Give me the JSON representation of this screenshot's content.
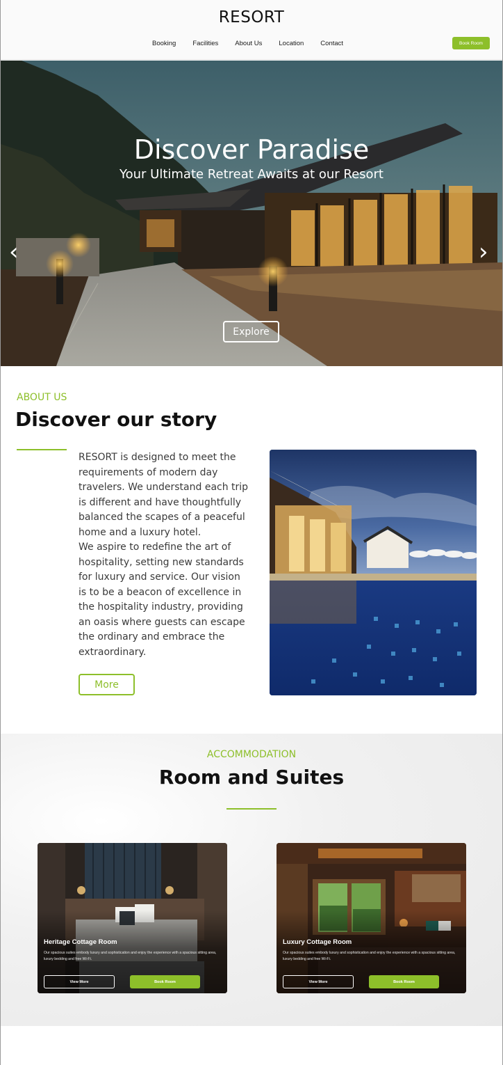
{
  "header": {
    "logo": "RESORT",
    "nav": [
      "Booking",
      "Facilities",
      "About Us",
      "Location",
      "Contact"
    ],
    "book_button": "Book Room"
  },
  "hero": {
    "title": "Discover Paradise",
    "subtitle": "Your Ultimate Retreat Awaits at our Resort",
    "explore_button": "Explore",
    "prev_arrow": "‹",
    "next_arrow": "›"
  },
  "about": {
    "eyebrow": "ABOUT US",
    "title": "Discover our story",
    "paragraph_1": "RESORT is designed to meet the requirements of modern day travelers. We understand each trip is different and have thoughtfully balanced the scapes of a peaceful home and a luxury hotel.",
    "paragraph_2": "We aspire to redefine the art of hospitality, setting new standards for luxury and service. Our vision is to be a beacon of excellence in the hospitality industry, providing an oasis where guests can escape the ordinary and embrace the extraordinary.",
    "more_button": "More"
  },
  "accommodation": {
    "eyebrow": "ACCOMMODATION",
    "title": "Room and Suites",
    "rooms": [
      {
        "name": "Heritage Cottage Room",
        "description": "Our spacious suites embody luxury and sophistication and enjoy the experience with a spacious sitting area, luxury bedding and free Wi-Fi.",
        "view_button": "View More",
        "book_button": "Book Room"
      },
      {
        "name": "Luxury Cottage Room",
        "description": "Our spacious suites embody luxury and sophistication and enjoy the experience with a spacious sitting area, luxury bedding and free Wi-Fi.",
        "view_button": "View More",
        "book_button": "Book Room"
      }
    ]
  },
  "colors": {
    "accent": "#8dbf2a",
    "text": "#1a1a1a"
  }
}
